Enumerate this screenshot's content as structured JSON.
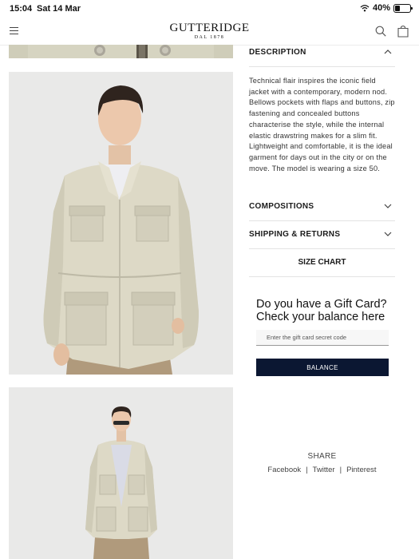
{
  "status_bar": {
    "time": "15:04",
    "date": "Sat 14 Mar",
    "battery": "40%",
    "battery_level": 0.4
  },
  "header": {
    "brand": "GUTTERIDGE",
    "brand_sub": "DAL 1878"
  },
  "accordion": {
    "description": {
      "label": "DESCRIPTION",
      "text": "Technical flair inspires the iconic field jacket with a contemporary, modern nod. Bellows pockets with flaps and buttons, zip fastening and concealed buttons characterise the style, while the internal elastic drawstring makes for a slim fit. Lightweight and comfortable, it is the ideal garment for days out in the city or on the move. The model is wearing a size 50."
    },
    "compositions": {
      "label": "COMPOSITIONS"
    },
    "shipping": {
      "label": "SHIPPING & RETURNS"
    }
  },
  "size_chart": {
    "label": "SIZE CHART"
  },
  "gift_card": {
    "title_line1": "Do you have a Gift Card?",
    "title_line2": "Check your balance here",
    "placeholder": "Enter the gift card secret code",
    "button": "BALANCE"
  },
  "share": {
    "title": "SHARE",
    "links": [
      "Facebook",
      "Twitter",
      "Pinterest"
    ],
    "separator": "|"
  },
  "colors": {
    "button_bg": "#0b1732",
    "jacket": "#ddd9c6",
    "trousers": "#b09a7c",
    "background": "#e9e9e8"
  },
  "icons": [
    "wifi-icon",
    "battery-icon",
    "menu-icon",
    "search-icon",
    "bag-icon",
    "chevron-up-icon",
    "chevron-down-icon"
  ]
}
